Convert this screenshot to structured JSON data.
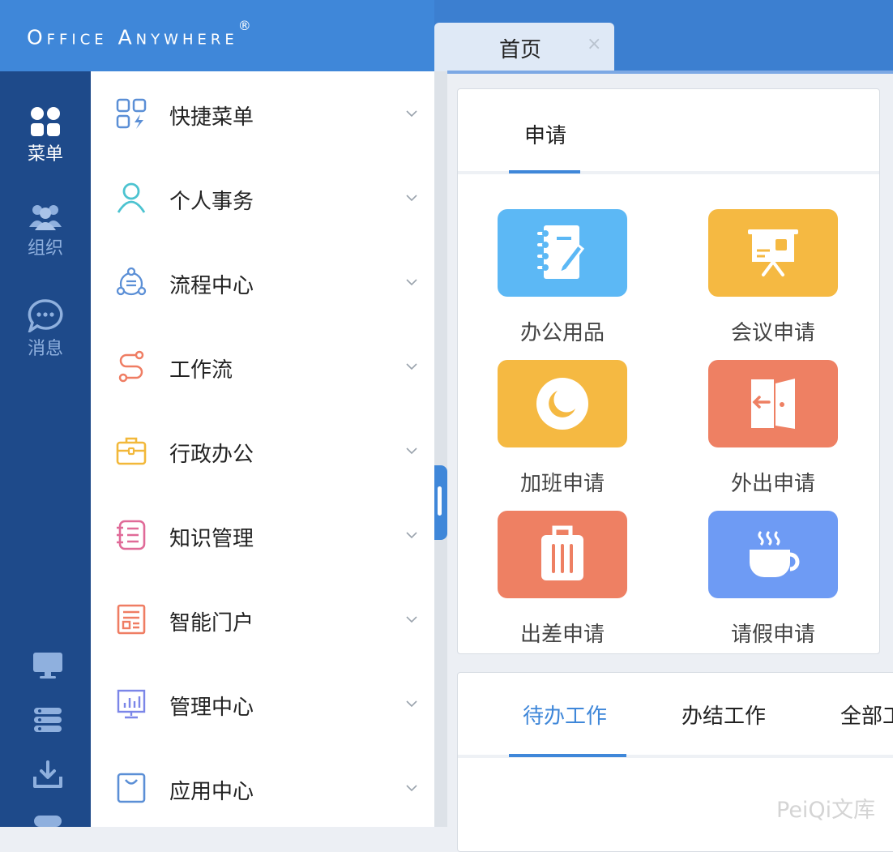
{
  "header": {
    "brand": "Office Anywhere",
    "brand_mark": "®",
    "tab_label": "首页",
    "tab_close": "×"
  },
  "rail": {
    "items": [
      {
        "label": "菜单",
        "icon": "grid-icon",
        "active": true
      },
      {
        "label": "组织",
        "icon": "people-icon"
      },
      {
        "label": "消息",
        "icon": "chat-icon"
      }
    ],
    "bottom_icons": [
      "monitor-icon",
      "server-icon",
      "download-icon",
      "more-icon"
    ]
  },
  "menu": {
    "items": [
      {
        "label": "快捷菜单",
        "icon": "quick-menu-icon",
        "color": "#5b8fd6"
      },
      {
        "label": "个人事务",
        "icon": "person-icon",
        "color": "#4cc3d0"
      },
      {
        "label": "流程中心",
        "icon": "process-icon",
        "color": "#5b8fd6"
      },
      {
        "label": "工作流",
        "icon": "workflow-icon",
        "color": "#ef7d63"
      },
      {
        "label": "行政办公",
        "icon": "briefcase-icon",
        "color": "#f2b83a"
      },
      {
        "label": "知识管理",
        "icon": "notebook-icon",
        "color": "#e06a98"
      },
      {
        "label": "智能门户",
        "icon": "portal-icon",
        "color": "#ef7d63"
      },
      {
        "label": "管理中心",
        "icon": "chart-board-icon",
        "color": "#7b86e8"
      },
      {
        "label": "应用中心",
        "icon": "bag-icon",
        "color": "#5b8fd6"
      }
    ]
  },
  "apply_card": {
    "tab_label": "申请",
    "apps": [
      {
        "label": "办公用品",
        "icon": "notepad-icon",
        "color": "#5cb8f5"
      },
      {
        "label": "会议申请",
        "icon": "presentation-icon",
        "color": "#f5b942"
      },
      {
        "label": "加班申请",
        "icon": "moon-icon",
        "color": "#f5b942"
      },
      {
        "label": "外出申请",
        "icon": "door-icon",
        "color": "#ee8063"
      },
      {
        "label": "出差申请",
        "icon": "luggage-icon",
        "color": "#ee8063"
      },
      {
        "label": "请假申请",
        "icon": "coffee-icon",
        "color": "#6e9bf4"
      }
    ]
  },
  "work_card": {
    "tabs": [
      "待办工作",
      "办结工作",
      "全部工作"
    ]
  },
  "watermark": "PeiQi文库",
  "colors": {
    "accent": "#3f87d9",
    "rail": "#1e4a8a"
  }
}
